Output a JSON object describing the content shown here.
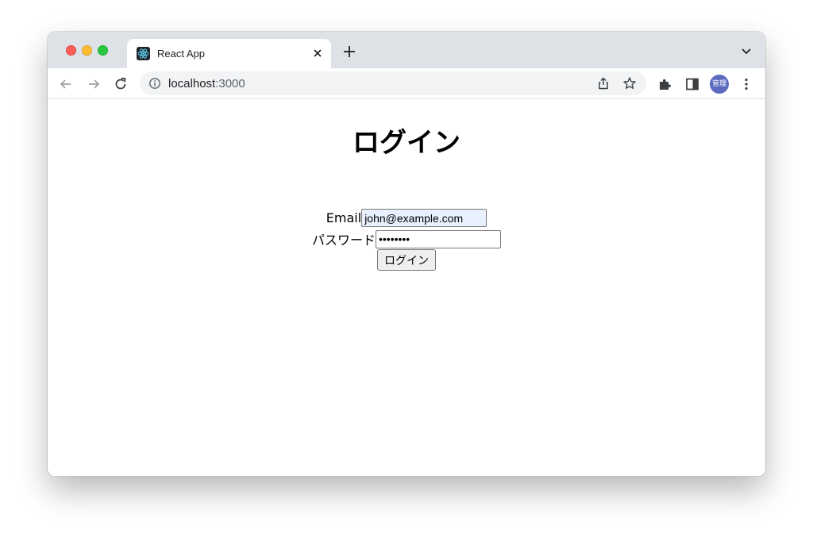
{
  "browser": {
    "tab_title": "React App",
    "url_host": "localhost",
    "url_port": ":3000",
    "profile_label": "管理",
    "icons": {
      "back": "back-arrow-icon",
      "forward": "forward-arrow-icon",
      "reload": "reload-icon",
      "info": "info-icon",
      "share": "share-icon",
      "bookmark": "star-icon",
      "extensions": "puzzle-icon",
      "side_panel": "side-panel-icon",
      "menu": "kebab-menu-icon",
      "tab_close": "close-icon",
      "new_tab": "plus-icon",
      "tab_list": "chevron-down-icon"
    }
  },
  "page": {
    "title": "ログイン",
    "email_label": "Email",
    "email_value": "john@example.com",
    "password_label": "パスワード",
    "password_value": "••••••••",
    "submit_label": "ログイン"
  },
  "colors": {
    "tabstrip": "#dee1e6",
    "autofill_bg": "#e8f0fe",
    "avatar": "#5c6bc0"
  }
}
